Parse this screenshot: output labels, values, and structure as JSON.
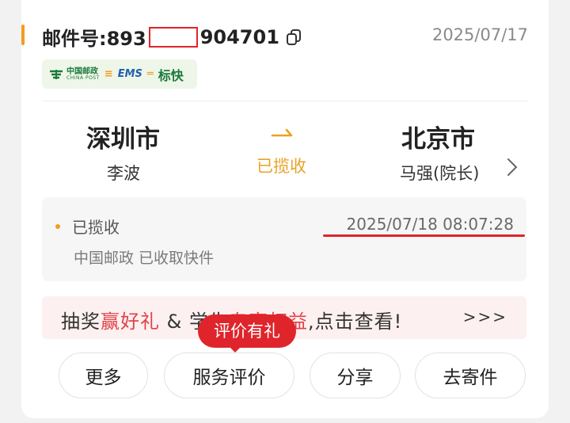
{
  "header": {
    "mail_prefix": "邮件号:893",
    "mail_suffix": "904701",
    "date": "2025/07/17"
  },
  "carrier": {
    "logo_cn": "中国邮政",
    "logo_en": "CHINA POST",
    "ems": "EMS",
    "service": "标快"
  },
  "route": {
    "from_city": "深圳市",
    "from_person": "李波",
    "to_city": "北京市",
    "to_person": "马强(院长)",
    "status": "已揽收"
  },
  "tracking": {
    "status": "已揽收",
    "time": "2025/07/18 08:07:28",
    "desc": "中国邮政 已收取快件"
  },
  "promo": {
    "part1": "抽奖",
    "highlight1": "赢好礼",
    "part2": " & 学生",
    "highlight2": "专享权益",
    "part3": ",点击查看!",
    "more": ">>>"
  },
  "badge": "评价有礼",
  "buttons": {
    "more": "更多",
    "rate": "服务评价",
    "share": "分享",
    "send": "去寄件"
  },
  "colors": {
    "accent": "#f29c1f",
    "status": "#e8a325",
    "red": "#e0242b",
    "green": "#1a7a3a"
  },
  "icons": {
    "copy": "copy-icon",
    "arrow": "right-arrow-icon",
    "chevron": "chevron-right-icon",
    "china_post_logo": "china-post-logo-icon"
  }
}
